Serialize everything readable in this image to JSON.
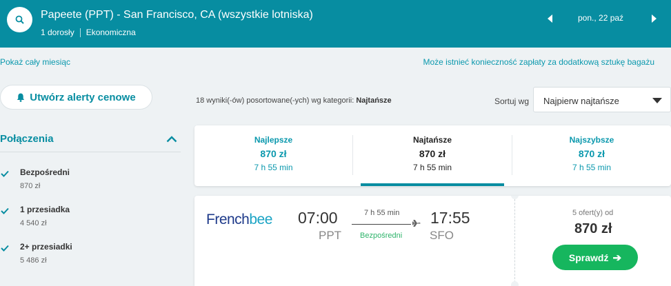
{
  "header": {
    "route": "Papeete (PPT) - San Francisco, CA (wszystkie lotniska)",
    "passengers": "1 dorosły",
    "cabin": "Ekonomiczna",
    "date": "pon., 22 paź"
  },
  "links": {
    "show_month": "Pokaż cały miesiąc",
    "baggage_notice": "Może istnieć konieczność zapłaty za dodatkową sztukę bagażu"
  },
  "alert_button": {
    "label": "Utwórz alerty cenowe"
  },
  "filters": {
    "title": "Połączenia",
    "items": [
      {
        "label": "Bezpośredni",
        "price": "870 zł",
        "checked": true
      },
      {
        "label": "1 przesiadka",
        "price": "4 540 zł",
        "checked": true
      },
      {
        "label": "2+ przesiadki",
        "price": "5 486 zł",
        "checked": true
      }
    ]
  },
  "results": {
    "count_text": "18 wyniki(-ów) posortowane(-ych) wg kategorii:",
    "sorted_by": "Najtańsze",
    "sort_label": "Sortuj wg",
    "sort_value": "Najpierw najtańsze"
  },
  "tabs": [
    {
      "name": "Najlepsze",
      "price": "870 zł",
      "duration": "7 h 55 min",
      "active": false
    },
    {
      "name": "Najtańsze",
      "price": "870 zł",
      "duration": "7 h 55 min",
      "active": true
    },
    {
      "name": "Najszybsze",
      "price": "870 zł",
      "duration": "7 h 55 min",
      "active": false
    }
  ],
  "flight": {
    "airline_logo": {
      "part1": "French",
      "part2": "bee"
    },
    "departure_time": "07:00",
    "departure_code": "PPT",
    "duration": "7 h 55 min",
    "stops": "Bezpośredni",
    "arrival_time": "17:55",
    "arrival_code": "SFO",
    "offers": "5 ofert(y) od",
    "price": "870 zł",
    "cta": "Sprawdź"
  },
  "colors": {
    "header_bg": "#078da1",
    "accent": "#0a98ad",
    "cta_green": "#16b65e",
    "direct_green": "#2db36a"
  },
  "icons": [
    "search-icon",
    "chevron-left-icon",
    "chevron-right-icon",
    "bell-icon",
    "chevron-up-icon",
    "check-icon",
    "caret-down-icon",
    "plane-icon",
    "arrow-right-icon"
  ]
}
